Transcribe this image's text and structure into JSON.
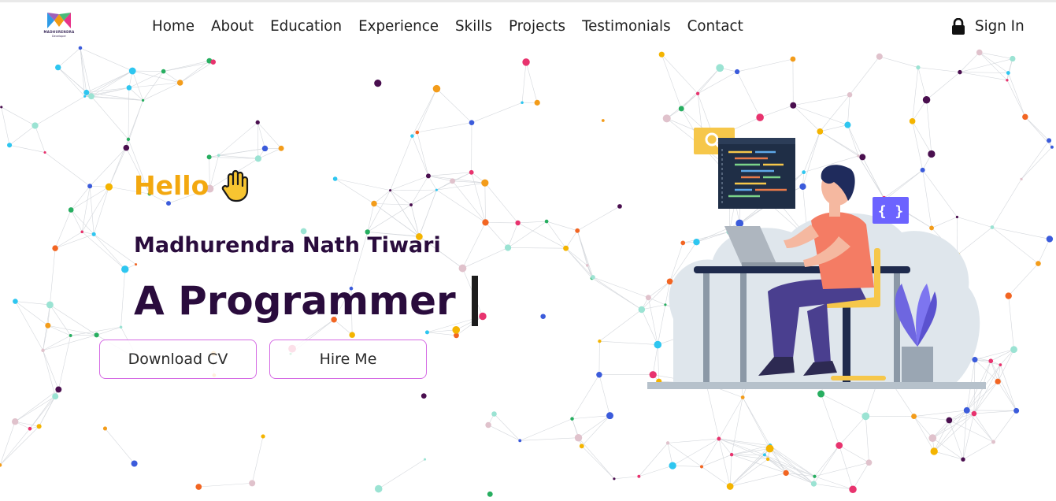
{
  "brand": {
    "logo_text": "MADHURENDRA",
    "logo_subtext": "Developer"
  },
  "nav": {
    "items": [
      {
        "label": "Home"
      },
      {
        "label": "About"
      },
      {
        "label": "Education"
      },
      {
        "label": "Experience"
      },
      {
        "label": "Skills"
      },
      {
        "label": "Projects"
      },
      {
        "label": "Testimonials"
      },
      {
        "label": "Contact"
      }
    ],
    "signin_label": "Sign In",
    "signin_icon": "lock-icon"
  },
  "hero": {
    "greeting": "Hello",
    "greeting_icon": "raised-hand-icon",
    "name": "Madhurendra Nath Tiwari",
    "role": "A Programmer",
    "buttons": {
      "download_cv": "Download CV",
      "hire_me": "Hire Me"
    },
    "illustration_badge": "{ }"
  },
  "colors": {
    "accent_yellow": "#f3a80f",
    "heading_purple": "#2a0c3d",
    "button_border": "#d56be4"
  }
}
